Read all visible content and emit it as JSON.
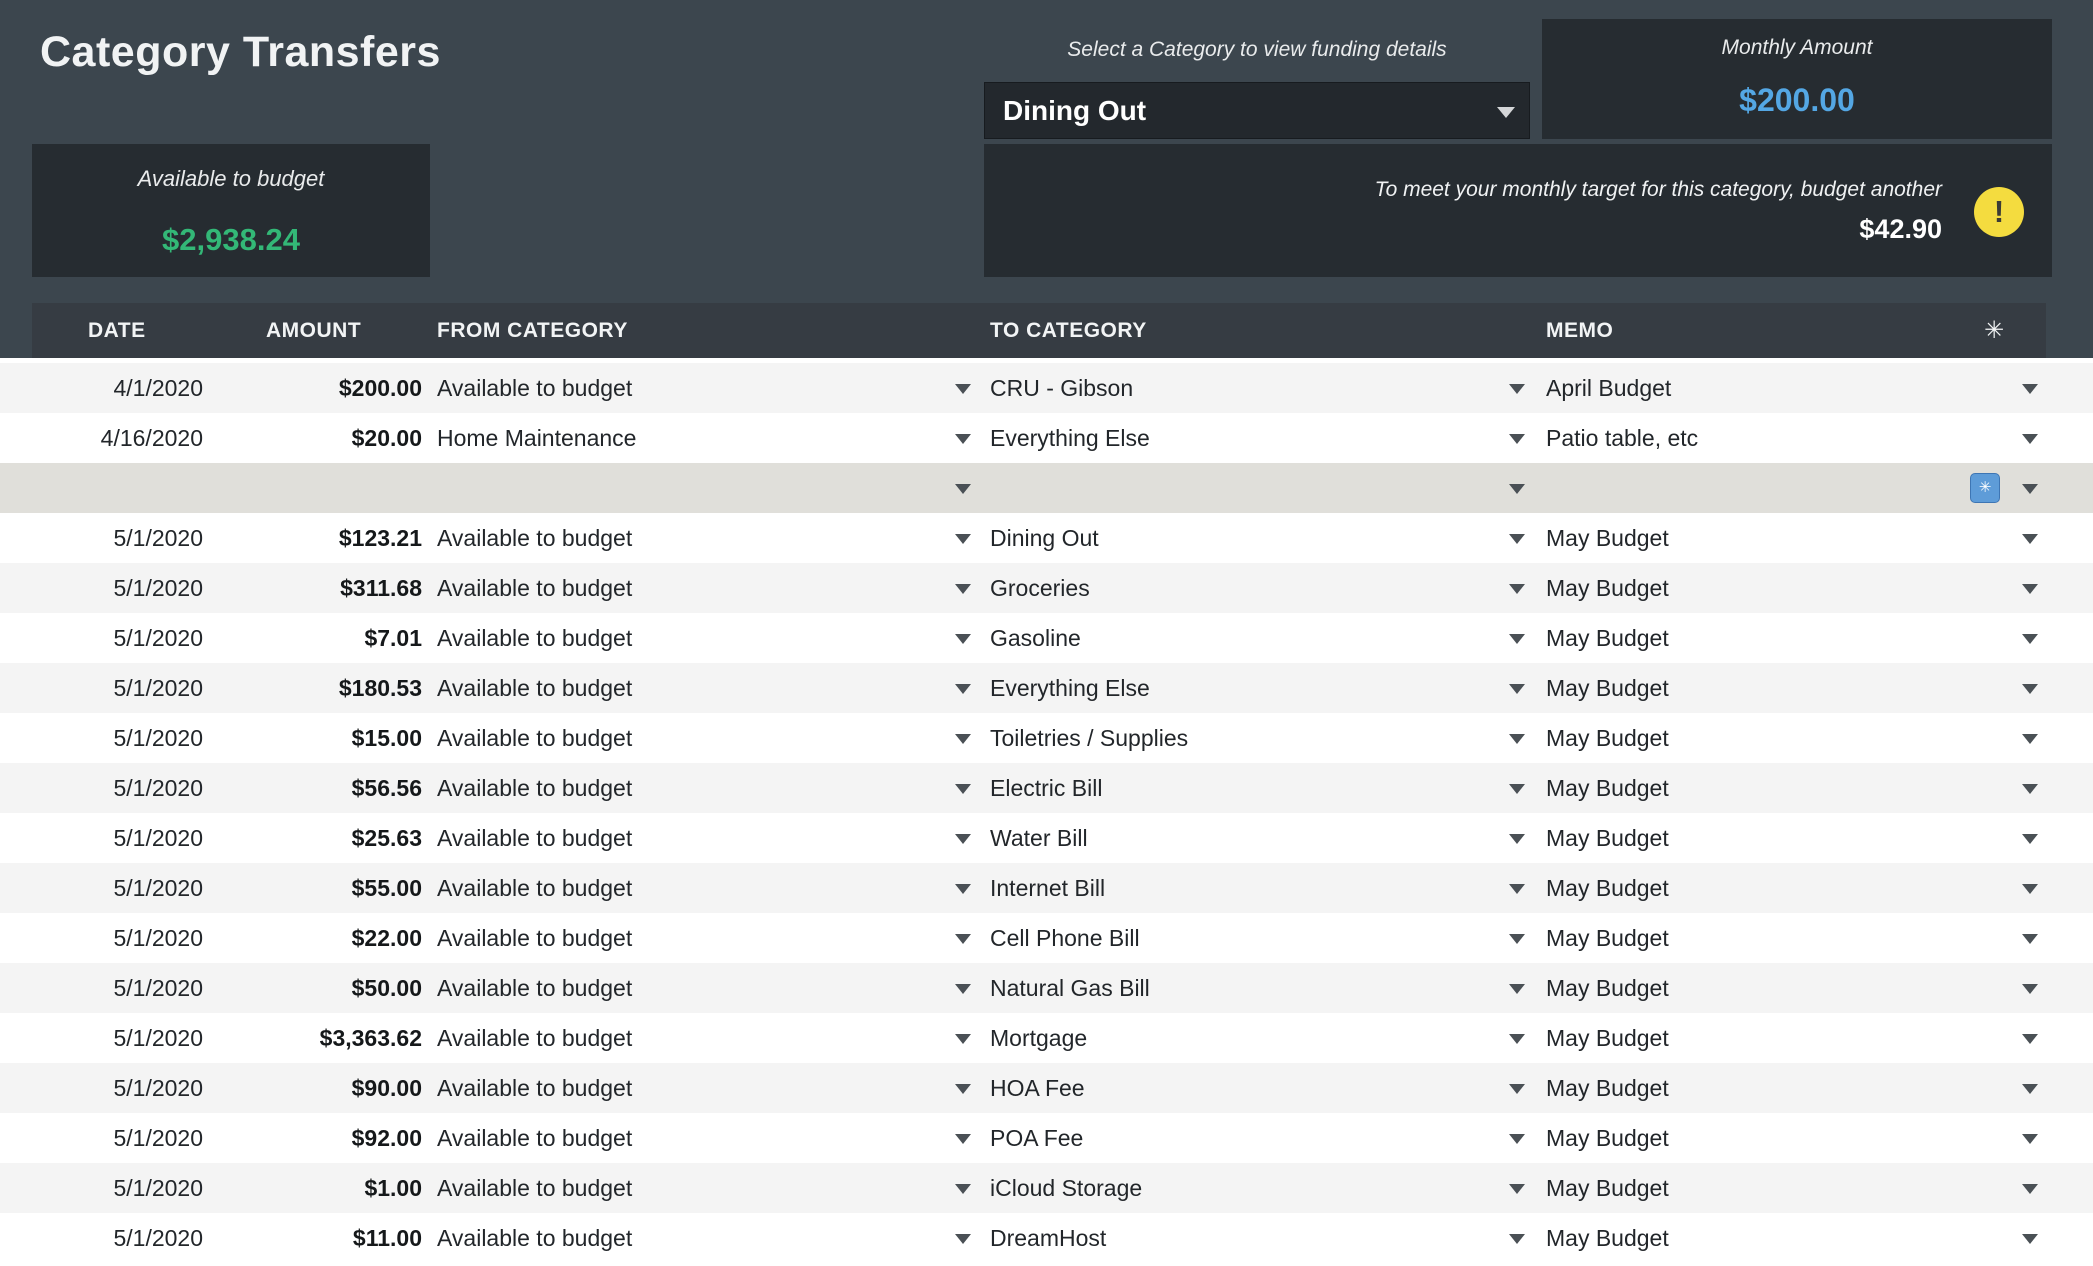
{
  "page": {
    "title": "Category Transfers"
  },
  "summary": {
    "available_label": "Available to budget",
    "available_value": "$2,938.24",
    "category_prompt": "Select a Category to view funding details",
    "category_selected": "Dining Out",
    "monthly_label": "Monthly Amount",
    "monthly_value": "$200.00",
    "target_message": "To meet your monthly target for this category, budget another",
    "target_amount": "$42.90"
  },
  "icons": {
    "warning": "!",
    "star": "✳"
  },
  "colors": {
    "page-bg": "#3C464E",
    "panel-bg": "#262C31",
    "select-bg": "#23282D",
    "header-bg": "#363C43",
    "green": "#33B877",
    "blue": "#54A7E4",
    "yellow": "#F4DC3F",
    "row-shade": "#F4F4F4",
    "row-plain": "#FFFFFF",
    "row-new": "#E0DFDA"
  },
  "table": {
    "headers": {
      "date": "DATE",
      "amount": "AMOUNT",
      "from": "FROM CATEGORY",
      "to": "TO CATEGORY",
      "memo": "MEMO"
    },
    "rows": [
      {
        "date": "4/1/2020",
        "amount": "$200.00",
        "from": "Available to budget",
        "to": "CRU - Gibson",
        "memo": "April Budget"
      },
      {
        "date": "4/16/2020",
        "amount": "$20.00",
        "from": "Home Maintenance",
        "to": "Everything Else",
        "memo": "Patio table, etc"
      },
      {
        "type": "new",
        "date": "",
        "amount": "",
        "from": "",
        "to": "",
        "memo": ""
      },
      {
        "date": "5/1/2020",
        "amount": "$123.21",
        "from": "Available to budget",
        "to": "Dining Out",
        "memo": "May Budget"
      },
      {
        "date": "5/1/2020",
        "amount": "$311.68",
        "from": "Available to budget",
        "to": "Groceries",
        "memo": "May Budget"
      },
      {
        "date": "5/1/2020",
        "amount": "$7.01",
        "from": "Available to budget",
        "to": "Gasoline",
        "memo": "May Budget"
      },
      {
        "date": "5/1/2020",
        "amount": "$180.53",
        "from": "Available to budget",
        "to": "Everything Else",
        "memo": "May Budget"
      },
      {
        "date": "5/1/2020",
        "amount": "$15.00",
        "from": "Available to budget",
        "to": "Toiletries / Supplies",
        "memo": "May Budget"
      },
      {
        "date": "5/1/2020",
        "amount": "$56.56",
        "from": "Available to budget",
        "to": "Electric Bill",
        "memo": "May Budget"
      },
      {
        "date": "5/1/2020",
        "amount": "$25.63",
        "from": "Available to budget",
        "to": "Water Bill",
        "memo": "May Budget"
      },
      {
        "date": "5/1/2020",
        "amount": "$55.00",
        "from": "Available to budget",
        "to": "Internet Bill",
        "memo": "May Budget"
      },
      {
        "date": "5/1/2020",
        "amount": "$22.00",
        "from": "Available to budget",
        "to": "Cell Phone Bill",
        "memo": "May Budget"
      },
      {
        "date": "5/1/2020",
        "amount": "$50.00",
        "from": "Available to budget",
        "to": "Natural Gas Bill",
        "memo": "May Budget"
      },
      {
        "date": "5/1/2020",
        "amount": "$3,363.62",
        "from": "Available to budget",
        "to": "Mortgage",
        "memo": "May Budget"
      },
      {
        "date": "5/1/2020",
        "amount": "$90.00",
        "from": "Available to budget",
        "to": "HOA Fee",
        "memo": "May Budget"
      },
      {
        "date": "5/1/2020",
        "amount": "$92.00",
        "from": "Available to budget",
        "to": "POA Fee",
        "memo": "May Budget"
      },
      {
        "date": "5/1/2020",
        "amount": "$1.00",
        "from": "Available to budget",
        "to": "iCloud Storage",
        "memo": "May Budget"
      },
      {
        "date": "5/1/2020",
        "amount": "$11.00",
        "from": "Available to budget",
        "to": "DreamHost",
        "memo": "May Budget"
      }
    ]
  }
}
